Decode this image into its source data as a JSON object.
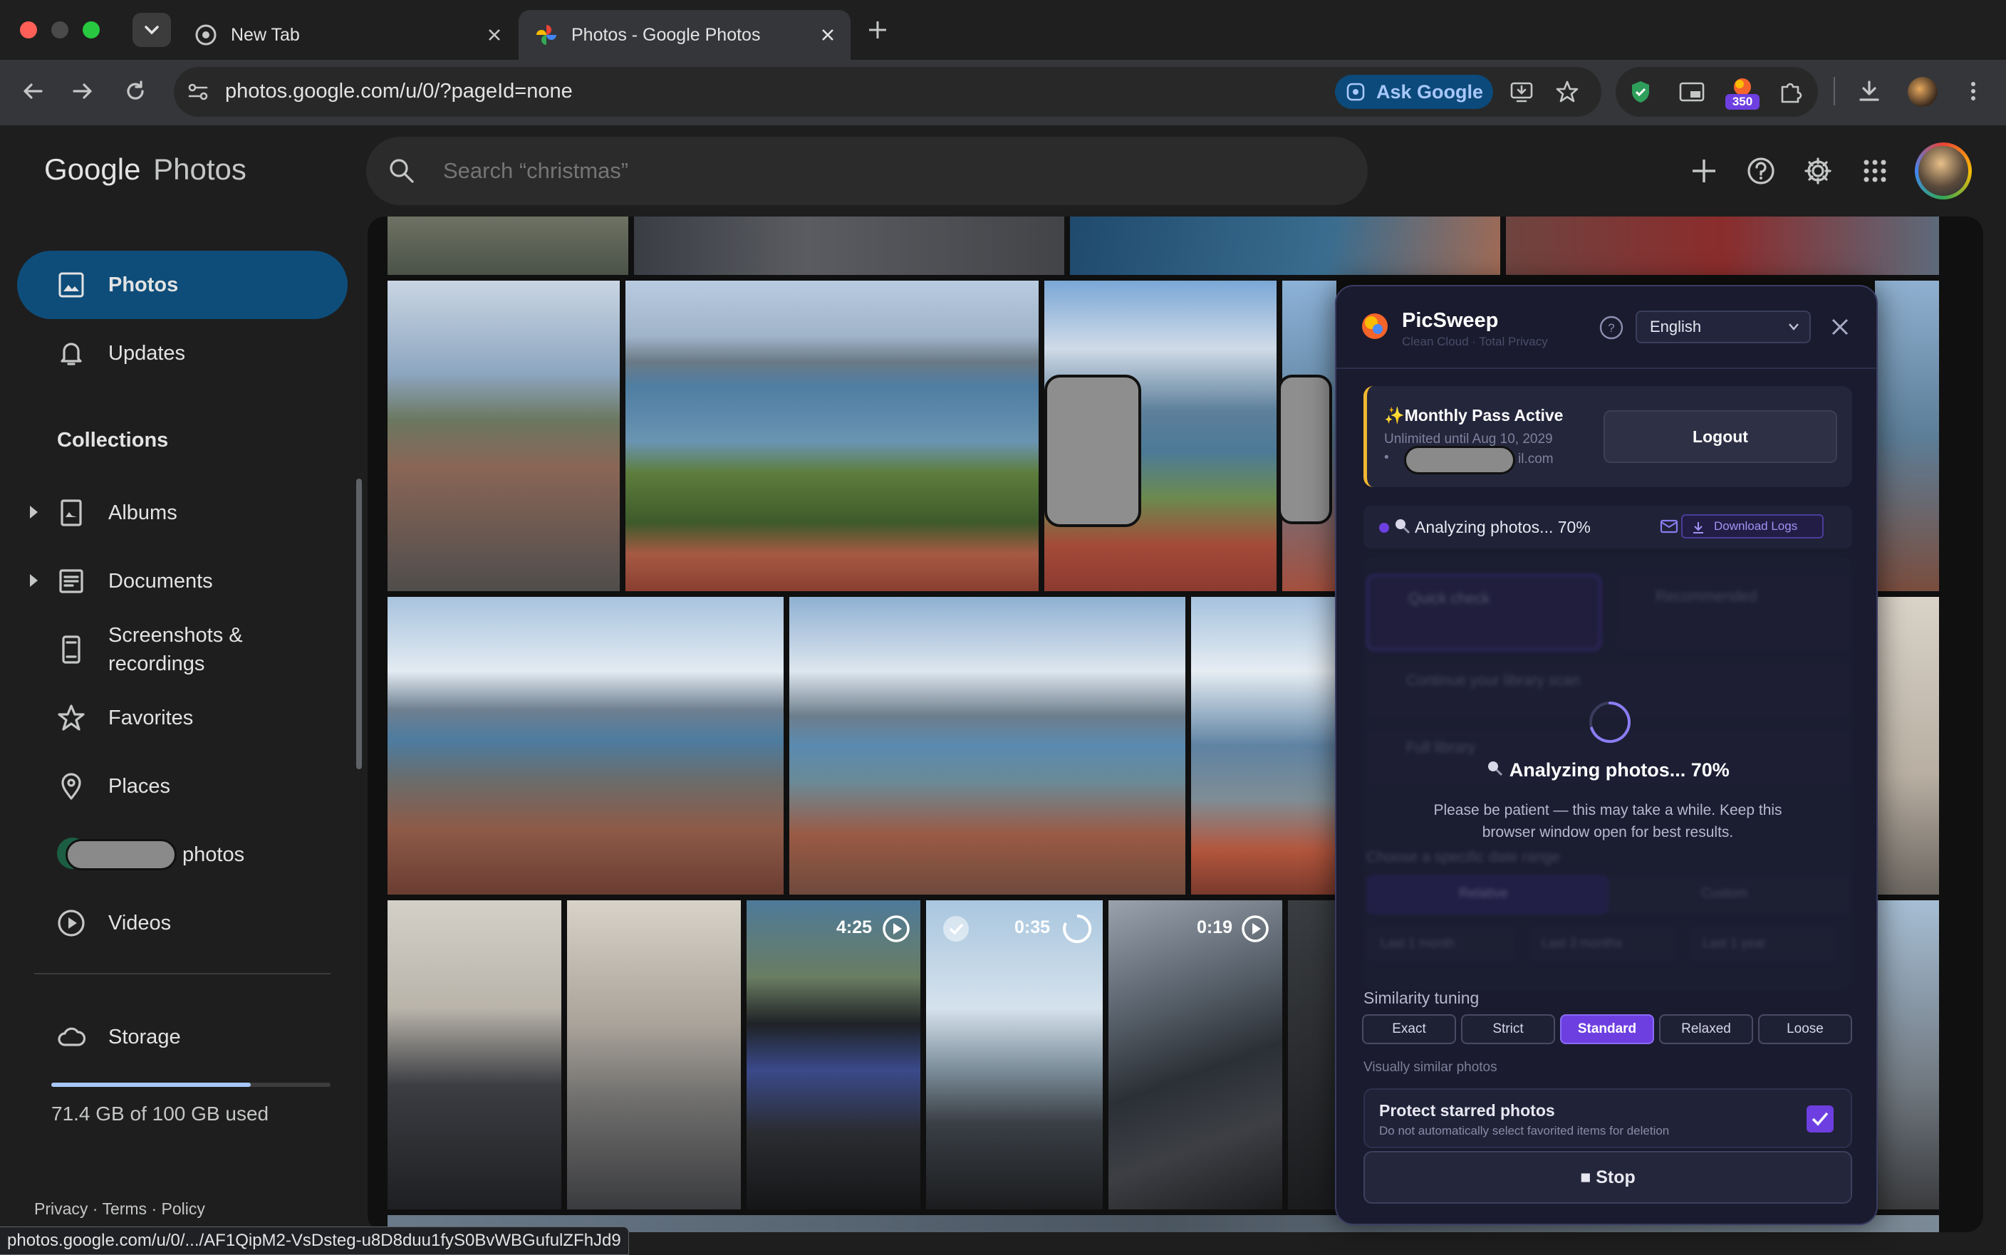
{
  "browser": {
    "tabs": [
      {
        "title": "New Tab",
        "icon": "chrome-icon"
      },
      {
        "title": "Photos - Google Photos",
        "icon": "photos-pinwheel-icon"
      }
    ],
    "url": "photos.google.com/u/0/?pageId=none",
    "ask_google": "Ask Google",
    "extension_badge": "350",
    "status_url": "photos.google.com/u/0/.../AF1QipM2-VsDsteg-u8D8duu1fyS0BvWBGufulZFhJd9"
  },
  "app": {
    "logo_google": "Google",
    "logo_photos": "Photos",
    "search_placeholder": "Search “christmas”"
  },
  "sidebar": {
    "photos": "Photos",
    "updates": "Updates",
    "collections": "Collections",
    "albums": "Albums",
    "documents": "Documents",
    "screenshots_line1": "Screenshots &",
    "screenshots_line2": "recordings",
    "favorites": "Favorites",
    "places": "Places",
    "people_suffix": "photos",
    "videos": "Videos",
    "storage": "Storage",
    "storage_used": "71.4 GB of 100 GB used",
    "storage_fraction": 0.714,
    "footer": [
      "Privacy",
      "Terms",
      "Policy"
    ]
  },
  "videos": [
    {
      "duration": "4:25"
    },
    {
      "duration": "0:35"
    },
    {
      "duration": "0:19"
    }
  ],
  "picsweep": {
    "title": "PicSweep",
    "tagline": "Clean Cloud · Total Privacy",
    "language": "English",
    "pass_title": "✨Monthly Pass Active",
    "pass_sub": "Unlimited until Aug 10, 2029",
    "email_suffix": "il.com",
    "logout": "Logout",
    "status": "Analyzing photos... 70%",
    "download_logs": "Download Logs",
    "progress_title": "Analyzing photos... 70%",
    "progress_note_1": "Please be patient — this may take a while. Keep this",
    "progress_note_2": "browser window open for best results.",
    "progress_fraction": 0.7,
    "bg_quick": "Quick check",
    "bg_recommended": "Recommended",
    "bg_continue": "Continue your library scan",
    "bg_full": "Full library",
    "bg_range": "Choose a specific date range",
    "bg_relative": "Relative",
    "bg_custom": "Custom",
    "bg_ranges": [
      "Last 1 month",
      "Last 3 months",
      "Last 1 year"
    ],
    "similarity_label": "Similarity tuning",
    "similarity_options": [
      "Exact",
      "Strict",
      "Standard",
      "Relaxed",
      "Loose"
    ],
    "similarity_selected": "Standard",
    "similarity_hint": "Visually similar photos",
    "protect_title": "Protect starred photos",
    "protect_sub": "Do not automatically select favorited items for deletion",
    "protect_checked": true,
    "stop": "■ Stop",
    "accent": "#6d3fe0"
  }
}
